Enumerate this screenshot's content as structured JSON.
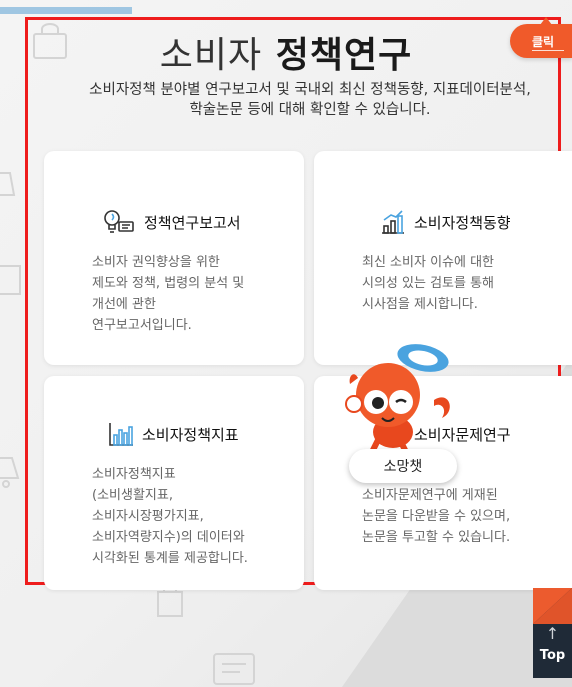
{
  "header": {
    "title_light": "소비자",
    "title_bold": "정책연구",
    "subtitle_line1": "소비자정책 분야별 연구보고서 및 국내외 최신 정책동향, 지표데이터분석,",
    "subtitle_line2": "학술논문 등에 대해 확인할 수 있습니다."
  },
  "click_badge": {
    "label": "클릭"
  },
  "cards": [
    {
      "title": "정책연구보고서",
      "icon": "lightbulb-report-icon",
      "description": "소비자 권익향상을 위한\n제도와 정책, 법령의 분석 및\n개선에 관한\n연구보고서입니다."
    },
    {
      "title": "소비자정책동향",
      "icon": "bar-trend-icon",
      "description": "최신 소비자 이슈에 대한\n시의성 있는 검토를 통해\n시사점을 제시합니다."
    },
    {
      "title": "소비자정책지표",
      "icon": "bar-chart-icon",
      "description": "소비자정책지표\n(소비생활지표,\n소비자시장평가지표,\n소비자역량지수)의 데이터와\n시각화된 통계를 제공합니다."
    },
    {
      "title": "소비자문제연구",
      "icon": "journal-icon",
      "description": "재학술지인\n소비자문제연구에 게재된\n논문을 다운받을 수 있으며,\n논문을 투고할 수 있습니다."
    }
  ],
  "chatbot": {
    "label": "소망챗",
    "icon": "mascot-icon"
  },
  "top_button": {
    "label": "Top",
    "icon": "arrow-up-icon"
  },
  "colors": {
    "highlight_frame": "#ee1c1c",
    "accent_orange": "#f05a2a",
    "top_button_bg": "#1f2a37"
  }
}
